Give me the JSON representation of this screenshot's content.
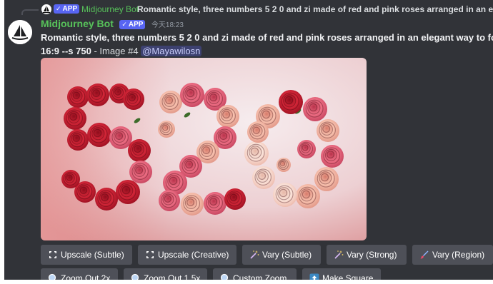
{
  "reply": {
    "app_tag": "APP",
    "author": "Midjourney Bot",
    "text": "Romantic style, three numbers 5 2 0 and zi made of red and pink roses arranged in an elegant wa"
  },
  "message": {
    "author": "Midjourney Bot",
    "app_tag": "APP",
    "timestamp": "今天18:23",
    "prompt": "Romantic style, three numbers 5 2 0 and zi made of red and pink roses arranged in an elegant way to form th",
    "params": "16:9 --s 750",
    "image_label": " - Image #4 ",
    "mention": "@Mayawilosn"
  },
  "image": {
    "subject": "red and pink roses forming 520",
    "colors": {
      "bg_light": "#f6e9ea",
      "bg_pink": "#e8a9a8",
      "rose_red": "#c81d2e",
      "rose_pink": "#e8667a",
      "rose_peach": "#f3b2a0"
    }
  },
  "buttons_row1": [
    {
      "label": "Upscale (Subtle)",
      "icon": "upscale-icon"
    },
    {
      "label": "Upscale (Creative)",
      "icon": "upscale-icon"
    },
    {
      "label": "Vary (Subtle)",
      "icon": "sparkle-wand-icon"
    },
    {
      "label": "Vary (Strong)",
      "icon": "sparkle-wand-icon"
    },
    {
      "label": "Vary (Region)",
      "icon": "brush-icon"
    }
  ],
  "buttons_row2": [
    {
      "label": "Zoom Out 2x",
      "icon": "zoom-icon"
    },
    {
      "label": "Zoom Out 1.5x",
      "icon": "zoom-icon"
    },
    {
      "label": "Custom Zoom",
      "icon": "zoom-icon"
    },
    {
      "label": "Make Square",
      "icon": "make-square-icon"
    }
  ],
  "theme": {
    "background": "#313338",
    "button": "#4e5058",
    "username_green": "#57c25a",
    "app_tag": "#5865f2"
  }
}
